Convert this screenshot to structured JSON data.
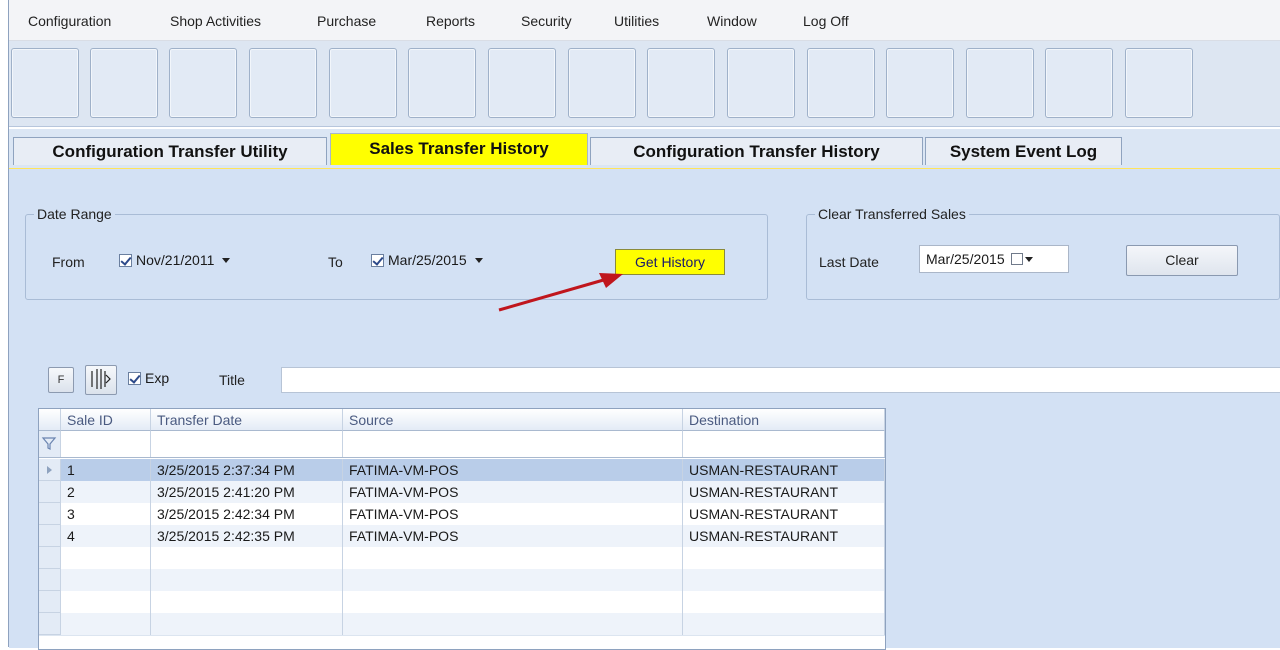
{
  "menu": [
    "Configuration",
    "Shop Activities",
    "Purchase",
    "Reports",
    "Security",
    "Utilities",
    "Window",
    "Log Off"
  ],
  "tabs": [
    "Configuration Transfer Utility",
    "Sales Transfer History",
    "Configuration Transfer History",
    "System Event Log"
  ],
  "active_tab": "Sales Transfer History",
  "date_range": {
    "title": "Date Range",
    "from_label": "From",
    "from_value": "Nov/21/2011",
    "from_checked": true,
    "to_label": "To",
    "to_value": "Mar/25/2015",
    "to_checked": true,
    "get_history_label": "Get History"
  },
  "clear_sales": {
    "title": "Clear Transferred Sales",
    "last_date_label": "Last Date",
    "last_date_value": "Mar/25/2015",
    "clear_label": "Clear"
  },
  "grid_toolbar": {
    "f_label": "F",
    "exp_label": "Exp",
    "exp_checked": true,
    "title_label": "Title",
    "title_value": ""
  },
  "grid": {
    "columns": [
      "Sale ID",
      "Transfer Date",
      "Source",
      "Destination"
    ],
    "rows": [
      {
        "sale_id": "1",
        "transfer_date": "3/25/2015 2:37:34 PM",
        "source": "FATIMA-VM-POS",
        "destination": "USMAN-RESTAURANT"
      },
      {
        "sale_id": "2",
        "transfer_date": "3/25/2015 2:41:20 PM",
        "source": "FATIMA-VM-POS",
        "destination": "USMAN-RESTAURANT"
      },
      {
        "sale_id": "3",
        "transfer_date": "3/25/2015 2:42:34 PM",
        "source": "FATIMA-VM-POS",
        "destination": "USMAN-RESTAURANT"
      },
      {
        "sale_id": "4",
        "transfer_date": "3/25/2015 2:42:35 PM",
        "source": "FATIMA-VM-POS",
        "destination": "USMAN-RESTAURANT"
      }
    ],
    "selected_row": 0
  },
  "colors": {
    "highlight": "#ffff00",
    "content_bg": "#d3e1f4",
    "selected_row": "#b9cde9",
    "arrow": "#c0161d"
  }
}
